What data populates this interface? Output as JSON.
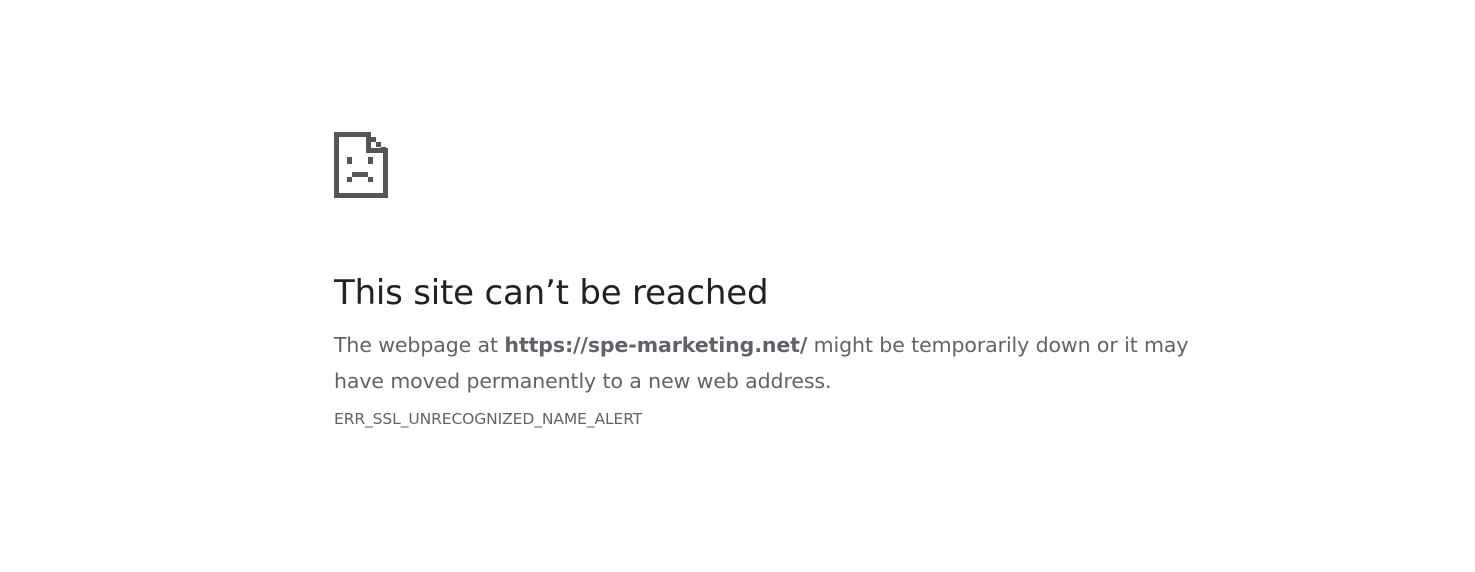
{
  "icon": {
    "name": "sad-page-icon",
    "color": "#555555"
  },
  "heading": "This site can’t be reached",
  "message": {
    "prefix": "The webpage at ",
    "url": "https://spe-marketing.net/",
    "suffix": " might be temporarily down or it may have moved permanently to a new web address."
  },
  "error_code": "ERR_SSL_UNRECOGNIZED_NAME_ALERT",
  "colors": {
    "heading": "#202124",
    "text": "#5f6368",
    "background": "#ffffff"
  }
}
